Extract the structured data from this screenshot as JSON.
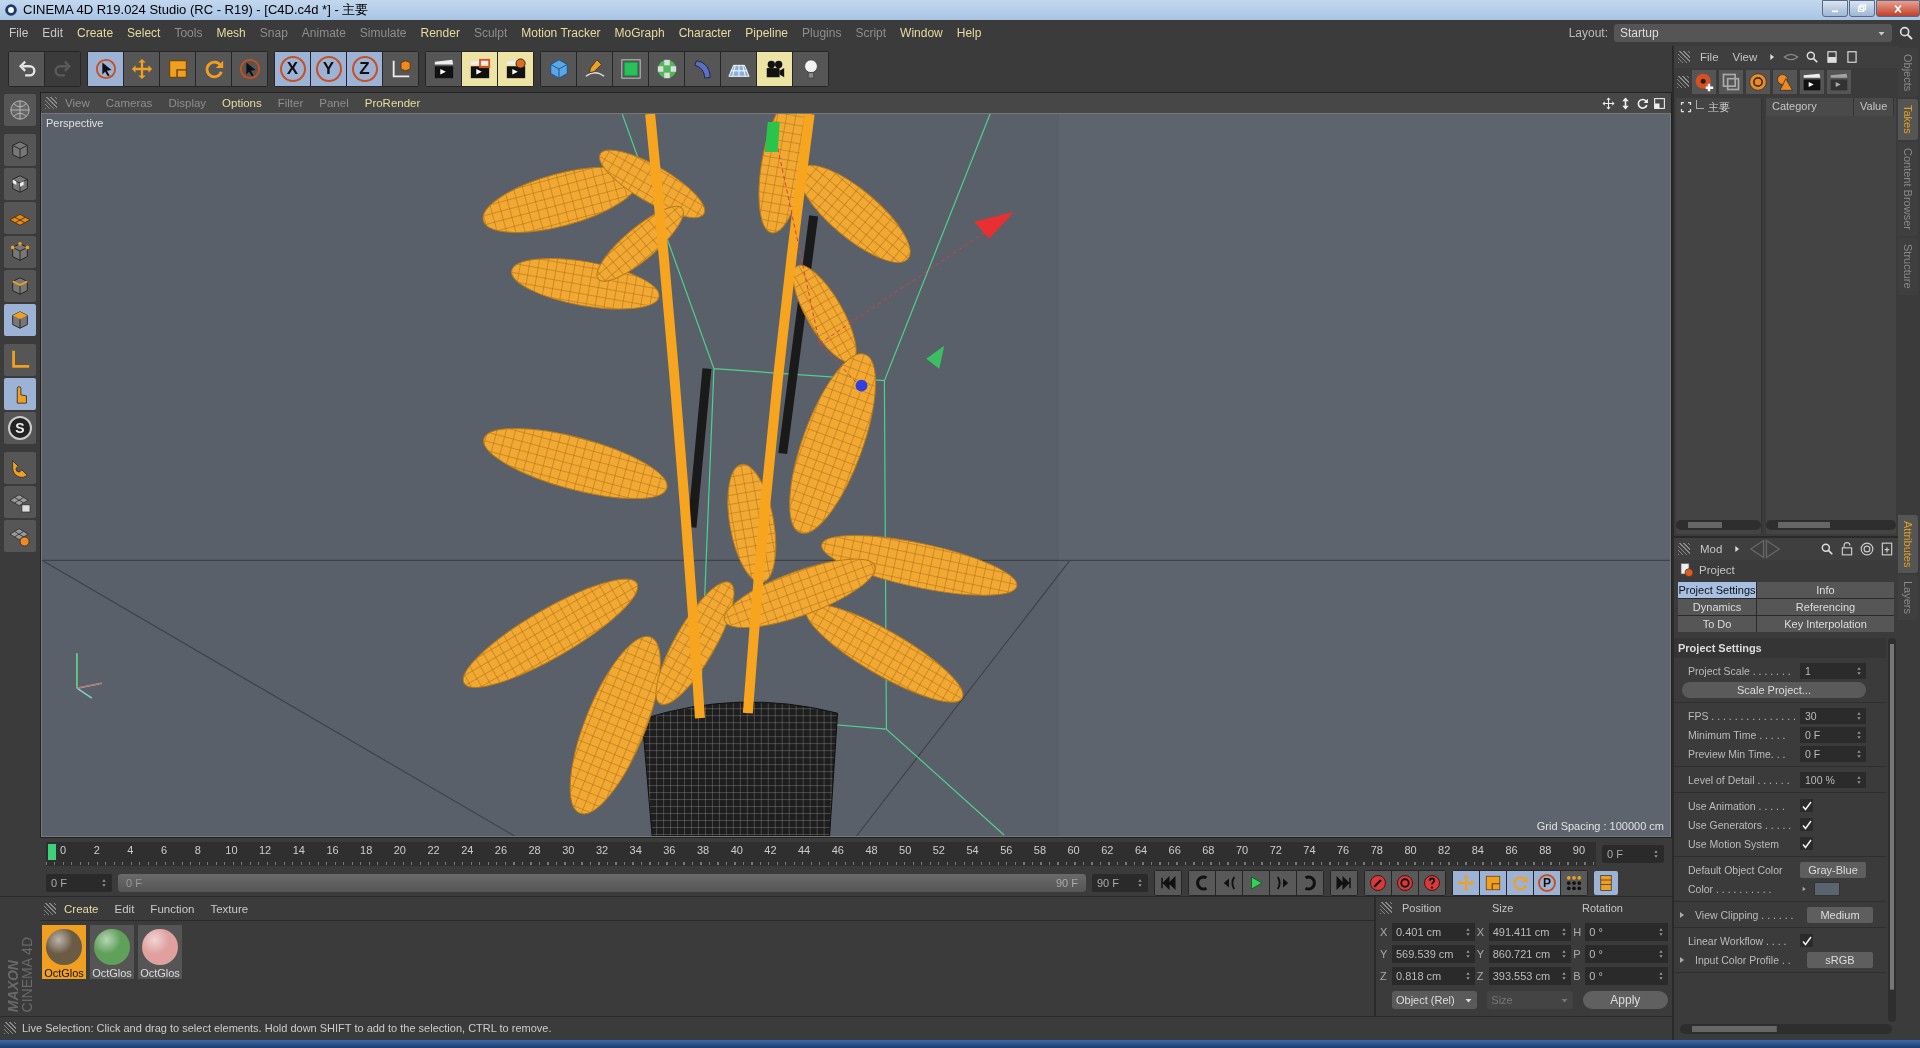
{
  "window": {
    "title": "CINEMA 4D R19.024 Studio (RC - R19) - [C4D.c4d *] - 主要"
  },
  "window_controls": [
    {
      "kind": "minimize"
    },
    {
      "kind": "maximize"
    },
    {
      "kind": "close"
    }
  ],
  "menu_bar": [
    {
      "label": "File",
      "kind": "normal"
    },
    {
      "label": "Edit",
      "kind": "normal"
    },
    {
      "label": "Create",
      "kind": "accent"
    },
    {
      "label": "Select",
      "kind": "accent"
    },
    {
      "label": "Tools",
      "kind": "dim"
    },
    {
      "label": "Mesh",
      "kind": "accent"
    },
    {
      "label": "Snap",
      "kind": "dim"
    },
    {
      "label": "Animate",
      "kind": "dim"
    },
    {
      "label": "Simulate",
      "kind": "dim"
    },
    {
      "label": "Render",
      "kind": "accent"
    },
    {
      "label": "Sculpt",
      "kind": "dim"
    },
    {
      "label": "Motion Tracker",
      "kind": "accent"
    },
    {
      "label": "MoGraph",
      "kind": "accent"
    },
    {
      "label": "Character",
      "kind": "accent"
    },
    {
      "label": "Pipeline",
      "kind": "accent"
    },
    {
      "label": "Plugins",
      "kind": "dim"
    },
    {
      "label": "Script",
      "kind": "dim"
    },
    {
      "label": "Window",
      "kind": "accent"
    },
    {
      "label": "Help",
      "kind": "accent"
    }
  ],
  "layout": {
    "label": "Layout:",
    "value": "Startup"
  },
  "toolbar": [
    [
      {
        "kind": "undo",
        "selected": false,
        "highlighted": false,
        "disabled": false
      },
      {
        "kind": "redo",
        "selected": false,
        "highlighted": false,
        "disabled": true
      }
    ],
    [
      {
        "kind": "live-selection",
        "selected": true,
        "highlighted": false,
        "disabled": false
      },
      {
        "kind": "move",
        "selected": false,
        "highlighted": false,
        "disabled": false
      },
      {
        "kind": "scale",
        "selected": false,
        "highlighted": false,
        "disabled": false
      },
      {
        "kind": "rotate",
        "selected": false,
        "highlighted": false,
        "disabled": false
      },
      {
        "kind": "recent",
        "selected": false,
        "highlighted": false,
        "disabled": false
      }
    ],
    [
      {
        "kind": "axis",
        "label": "X",
        "selected": true,
        "highlighted": false,
        "disabled": false
      },
      {
        "kind": "axis",
        "label": "Y",
        "selected": true,
        "highlighted": false,
        "disabled": false
      },
      {
        "kind": "axis",
        "label": "Z",
        "selected": true,
        "highlighted": false,
        "disabled": false
      },
      {
        "kind": "coord",
        "selected": false,
        "highlighted": false,
        "disabled": false
      }
    ],
    [
      {
        "kind": "render-view",
        "selected": false,
        "highlighted": false,
        "disabled": false
      },
      {
        "kind": "render-picture",
        "selected": false,
        "highlighted": true,
        "disabled": false
      },
      {
        "kind": "render-settings",
        "selected": false,
        "highlighted": true,
        "disabled": false
      }
    ],
    [
      {
        "kind": "cube",
        "selected": false,
        "highlighted": false,
        "disabled": false
      },
      {
        "kind": "pen",
        "selected": false,
        "highlighted": false,
        "disabled": false
      },
      {
        "kind": "subdivision",
        "selected": false,
        "highlighted": false,
        "disabled": false
      },
      {
        "kind": "cloner",
        "selected": false,
        "highlighted": false,
        "disabled": false
      },
      {
        "kind": "deformer",
        "selected": false,
        "highlighted": false,
        "disabled": false
      },
      {
        "kind": "floor",
        "selected": false,
        "highlighted": false,
        "disabled": false
      },
      {
        "kind": "camera",
        "selected": false,
        "highlighted": true,
        "disabled": false
      },
      {
        "kind": "light",
        "selected": false,
        "highlighted": false,
        "disabled": false
      }
    ]
  ],
  "left_tools": [
    {
      "kind": "make-editable",
      "selected": false
    },
    {
      "kind": "model",
      "selected": false
    },
    {
      "kind": "texture",
      "selected": false
    },
    {
      "kind": "workplane",
      "selected": false
    },
    {
      "kind": "points",
      "selected": false
    },
    {
      "kind": "edges",
      "selected": false
    },
    {
      "kind": "polygons",
      "selected": true
    },
    {
      "kind": "axis-mode",
      "selected": false
    },
    {
      "kind": "tweak",
      "selected": true
    },
    {
      "kind": "snap",
      "label": "S",
      "selected": false
    },
    {
      "kind": "magnet",
      "selected": false
    },
    {
      "kind": "lock-workplane",
      "selected": false
    },
    {
      "kind": "grid-workplane",
      "selected": false
    }
  ],
  "viewport": {
    "menu": [
      {
        "label": "View",
        "kind": "dim"
      },
      {
        "label": "Cameras",
        "kind": "dim"
      },
      {
        "label": "Display",
        "kind": "dim"
      },
      {
        "label": "Options",
        "kind": "accent"
      },
      {
        "label": "Filter",
        "kind": "dim"
      },
      {
        "label": "Panel",
        "kind": "dim"
      },
      {
        "label": "ProRender",
        "kind": "accent"
      }
    ],
    "nav": [
      {
        "kind": "move"
      },
      {
        "kind": "zoom"
      },
      {
        "kind": "rotate"
      },
      {
        "kind": "maximize"
      }
    ],
    "camera": "Perspective",
    "grid_spacing": "Grid Spacing : 100000 cm"
  },
  "timeline": {
    "ticks": [
      "0",
      "2",
      "4",
      "6",
      "8",
      "10",
      "12",
      "14",
      "16",
      "18",
      "20",
      "22",
      "24",
      "26",
      "28",
      "30",
      "32",
      "34",
      "36",
      "38",
      "40",
      "42",
      "44",
      "46",
      "48",
      "50",
      "52",
      "54",
      "56",
      "58",
      "60",
      "62",
      "64",
      "66",
      "68",
      "70",
      "72",
      "74",
      "76",
      "78",
      "80",
      "82",
      "84",
      "86",
      "88",
      "90"
    ],
    "playhead": {
      "level": 0
    },
    "current_frame": "0 F",
    "start_field": "0 F",
    "range": {
      "start": "0 F",
      "end": "90 F",
      "level": 1
    },
    "end_field": "90 F",
    "transport": [
      {
        "kind": "first"
      },
      {
        "kind": "prev-key"
      },
      {
        "kind": "prev-frame"
      },
      {
        "kind": "play"
      },
      {
        "kind": "next-frame"
      },
      {
        "kind": "next-key"
      },
      {
        "kind": "last"
      }
    ],
    "record": [
      {
        "kind": "record"
      },
      {
        "kind": "autokey"
      },
      {
        "kind": "keyset"
      }
    ],
    "key_tracks": [
      {
        "kind": "move",
        "selected": true
      },
      {
        "kind": "scale",
        "selected": true
      },
      {
        "kind": "rotate",
        "selected": true
      },
      {
        "kind": "param",
        "label": "P",
        "selected": true
      },
      {
        "kind": "points",
        "selected": false
      }
    ],
    "timeline_button": {
      "selected": true
    }
  },
  "materials": {
    "menu": [
      {
        "label": "Create",
        "kind": "accent"
      },
      {
        "label": "Edit",
        "kind": "normal"
      },
      {
        "label": "Function",
        "kind": "normal"
      },
      {
        "label": "Texture",
        "kind": "normal"
      }
    ],
    "items": [
      {
        "name": "OctGlos",
        "color": "#6b5b45",
        "selected": true
      },
      {
        "name": "OctGlos",
        "color": "#5fa05a",
        "selected": false
      },
      {
        "name": "OctGlos",
        "color": "#e0a0a0",
        "selected": false
      }
    ]
  },
  "logo": {
    "lines": [
      "MAXON",
      "CINEMA 4D"
    ]
  },
  "coordinates": {
    "headers": [
      "Position",
      "Size",
      "Rotation"
    ],
    "rows": [
      [
        {
          "axis": "X",
          "value": "0.401 cm"
        },
        {
          "axis": "X",
          "value": "491.411 cm"
        },
        {
          "axis": "H",
          "value": "0 °"
        }
      ],
      [
        {
          "axis": "Y",
          "value": "569.539 cm"
        },
        {
          "axis": "Y",
          "value": "860.721 cm"
        },
        {
          "axis": "P",
          "value": "0 °"
        }
      ],
      [
        {
          "axis": "Z",
          "value": "0.818 cm"
        },
        {
          "axis": "Z",
          "value": "393.553 cm"
        },
        {
          "axis": "B",
          "value": "0 °"
        }
      ]
    ],
    "mode": "Object (Rel)",
    "size_mode": {
      "label": "Size",
      "disabled": true
    },
    "apply": "Apply"
  },
  "status_bar": {
    "text": "Live Selection: Click and drag to select elements. Hold down SHIFT to add to the selection, CTRL to remove."
  },
  "takes_manager": {
    "menu": [
      "File",
      "View"
    ],
    "tools": [
      {
        "kind": "add-take"
      },
      {
        "kind": "clone-take"
      },
      {
        "kind": "override"
      },
      {
        "kind": "auto-take"
      },
      {
        "kind": "render-take"
      },
      {
        "kind": "render-all"
      }
    ],
    "takes": [
      {
        "label": "主要"
      }
    ],
    "columns": [
      "Category",
      "Value"
    ]
  },
  "side_tabs_top": [
    {
      "label": "Objects",
      "selected": false
    },
    {
      "label": "Takes",
      "selected": true
    },
    {
      "label": "Content Browser",
      "selected": false
    },
    {
      "label": "Structure",
      "selected": false
    }
  ],
  "attributes": {
    "menu": "Mod",
    "object": "Project",
    "tabs": [
      {
        "label": "Project Settings",
        "selected": true
      },
      {
        "label": "Info",
        "selected": false
      },
      {
        "label": "Dynamics",
        "selected": false
      },
      {
        "label": "Referencing",
        "selected": false
      },
      {
        "label": "To Do",
        "selected": false
      },
      {
        "label": "Key Interpolation",
        "selected": false
      }
    ],
    "section": "Project Settings",
    "groups": [
      [
        {
          "kind": "number",
          "label": "Project Scale . . . . . . .",
          "value": "1",
          "expandable": false
        },
        {
          "kind": "button",
          "label": "Scale Project...",
          "expandable": false
        }
      ],
      [
        {
          "kind": "number",
          "label": "FPS . . . . . . . . . . . . . . .",
          "value": "30",
          "expandable": false
        },
        {
          "kind": "number",
          "label": "Minimum Time . . . . .",
          "value": "0 F",
          "expandable": false
        },
        {
          "kind": "number",
          "label": "Preview Min Time. . .",
          "value": "0 F",
          "expandable": false
        }
      ],
      [
        {
          "kind": "number",
          "label": "Level of Detail . . . . . .",
          "value": "100 %",
          "expandable": false
        }
      ],
      [
        {
          "kind": "checkbox",
          "label": "Use Animation . . . . .",
          "checked": true,
          "expandable": false
        },
        {
          "kind": "checkbox",
          "label": "Use Generators . . . . .",
          "checked": true,
          "expandable": false
        },
        {
          "kind": "checkbox",
          "label": "Use Motion System",
          "checked": true,
          "expandable": false
        }
      ],
      [
        {
          "kind": "dropdown",
          "label": "Default Object Color",
          "value": "Gray-Blue",
          "expandable": false
        },
        {
          "kind": "color",
          "label": "Color . . . . . . . . . .",
          "color": "#5b6270",
          "expandable": false
        }
      ],
      [
        {
          "kind": "dropdown",
          "label": "View Clipping . . . . . .",
          "value": "Medium",
          "expandable": true
        }
      ],
      [
        {
          "kind": "checkbox",
          "label": "Linear Workflow . . . .",
          "checked": true,
          "expandable": false
        },
        {
          "kind": "dropdown",
          "label": "Input Color Profile . .",
          "value": "sRGB",
          "expandable": true
        }
      ]
    ]
  },
  "side_tabs_bottom": [
    {
      "label": "Attributes",
      "selected": true
    },
    {
      "label": "Layers",
      "selected": false
    }
  ]
}
